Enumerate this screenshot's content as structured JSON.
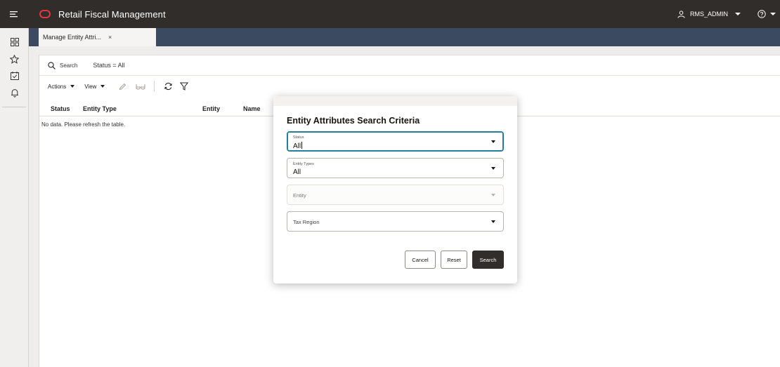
{
  "header": {
    "app_title": "Retail Fiscal Management",
    "user": "RMS_ADMIN",
    "brand_color": "#312d2a",
    "logo_color": "#e4363b"
  },
  "rail": {
    "icons": [
      "dashboard-icon",
      "star-icon",
      "tasks-icon",
      "bell-icon"
    ]
  },
  "tabs": [
    {
      "label": "Manage Entity Attri...",
      "close": "×"
    }
  ],
  "search_bar": {
    "search_label": "Search",
    "status_filter": "Status = All"
  },
  "toolbar": {
    "actions_label": "Actions",
    "view_label": "View",
    "icons": [
      "edit-icon",
      "view-glasses-icon",
      "refresh-icon",
      "filter-icon"
    ]
  },
  "table": {
    "columns": [
      "Status",
      "Entity Type",
      "Entity",
      "Name"
    ],
    "empty_message": "No data. Please refresh the table."
  },
  "dialog": {
    "title": "Entity Attributes Search Criteria",
    "fields": [
      {
        "label": "Status",
        "value": "All",
        "state": "focused"
      },
      {
        "label": "Entity Types",
        "value": "All",
        "state": "normal"
      },
      {
        "label": "Entity",
        "value": "",
        "state": "disabled"
      },
      {
        "label": "Tax Region",
        "value": "",
        "state": "normal"
      }
    ],
    "buttons": {
      "cancel": "Cancel",
      "reset": "Reset",
      "search": "Search"
    },
    "focus_color": "#227e9e"
  }
}
